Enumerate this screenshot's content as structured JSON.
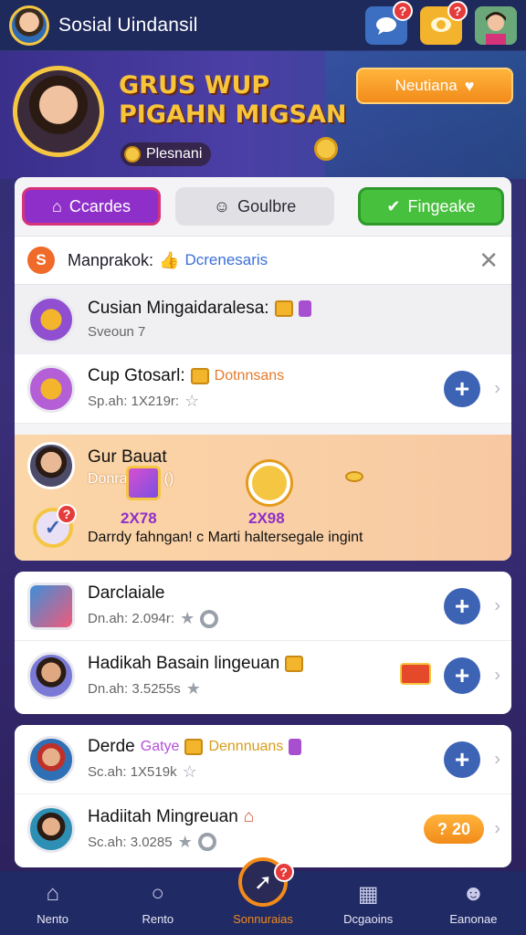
{
  "topbar": {
    "title": "Sosial Uindansil",
    "chat_badge": "?",
    "coin_badge": "?"
  },
  "hero": {
    "title_line1": "GRUS WUP",
    "title_line2": "PIGAHN MIGSAN",
    "subtitle": "Plesnani",
    "button_label": "Neutiana"
  },
  "tabs": [
    {
      "label": "Ccardes"
    },
    {
      "label": "Goulbre"
    },
    {
      "label": "Fingeake"
    }
  ],
  "notice": {
    "icon_letter": "S",
    "text": "Manprakok:",
    "link": "Dcrenesaris"
  },
  "rows": [
    {
      "title": "Cusian Mingaidaralesa:",
      "meta": "Sveoun 7"
    },
    {
      "title": "Cup Gtosarl:",
      "tag": "Dotnnsans",
      "meta": "Sp.ah: 1X219r:"
    },
    {
      "title": "Darclaiale",
      "meta": "Dn.ah: 2.094r:"
    },
    {
      "title": "Hadikah Basain lingeuan",
      "meta": "Dn.ah: 3.5255s"
    },
    {
      "title": "Derde",
      "tag_purple": "Gatye",
      "tag": "Dennnuans",
      "meta": "Sc.ah: 1X519k"
    },
    {
      "title": "Hadiitah Mingreuan",
      "meta": "Sc.ah: 3.0285",
      "pill": "? 20"
    }
  ],
  "highlight": {
    "title": "Gur Bauat",
    "sub": "Donrantom ()",
    "num1": "2X78",
    "num2": "2X98",
    "desc": "Darrdy fahngan! c Marti haltersegale ingint",
    "check_badge": "?"
  },
  "bottom_nav": [
    {
      "label": "Nento"
    },
    {
      "label": "Rento"
    },
    {
      "label": "Sonnuraias",
      "badge": "?"
    },
    {
      "label": "Dcgaoins"
    },
    {
      "label": "Eanonae"
    }
  ],
  "colors": {
    "accent_orange": "#f28b1a",
    "accent_purple": "#8f2fc9",
    "accent_green": "#46c03d",
    "nav_bg": "#202a64"
  }
}
